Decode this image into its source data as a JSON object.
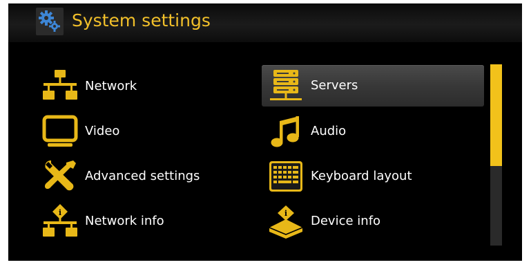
{
  "header": {
    "title": "System settings",
    "icon": "settings-gears-icon"
  },
  "menu": {
    "items": [
      {
        "label": "Network",
        "icon": "network-icon",
        "selected": false
      },
      {
        "label": "Servers",
        "icon": "servers-icon",
        "selected": true
      },
      {
        "label": "Video",
        "icon": "video-icon",
        "selected": false
      },
      {
        "label": "Audio",
        "icon": "audio-icon",
        "selected": false
      },
      {
        "label": "Advanced settings",
        "icon": "tools-icon",
        "selected": false
      },
      {
        "label": "Keyboard layout",
        "icon": "keyboard-icon",
        "selected": false
      },
      {
        "label": "Network info",
        "icon": "network-info-icon",
        "selected": false
      },
      {
        "label": "Device info",
        "icon": "device-info-icon",
        "selected": false
      }
    ]
  },
  "scrollbar": {
    "visible_fraction": 0.56,
    "position": 0
  },
  "colors": {
    "accent": "#f2c21b",
    "title": "#f2c02a",
    "background": "#000000",
    "label": "#ffffff"
  }
}
